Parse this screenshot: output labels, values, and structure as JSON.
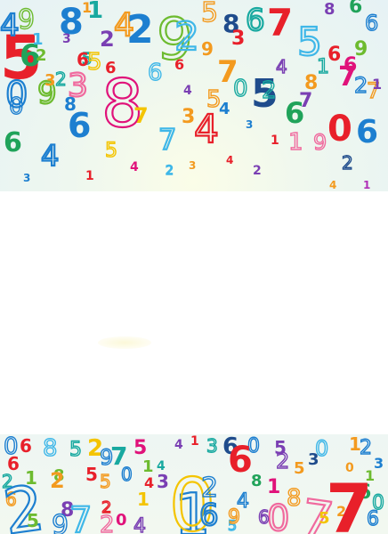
{
  "colors": {
    "red": "#e8202a",
    "magenta": "#e0127a",
    "pink": "#f06a9e",
    "orange": "#f39a1f",
    "yellow": "#f4c400",
    "green": "#6dbb2f",
    "dark_green": "#20a35a",
    "teal": "#18a9a0",
    "blue": "#1d7fd0",
    "navy": "#1f4c8c",
    "purple": "#7a3fb3",
    "violet": "#b02fb8",
    "sky": "#3fb7e8",
    "gray_blue": "#5b7fb3"
  },
  "top_band": {
    "name": "colorful-numbers-top-band",
    "digits": [
      {
        "t": "5",
        "c": "red",
        "s": 68,
        "style": "bold"
      },
      {
        "t": "8",
        "c": "blue",
        "s": 40,
        "style": "bold"
      },
      {
        "t": "1",
        "c": "teal",
        "s": 26,
        "style": "bold"
      },
      {
        "t": "2",
        "c": "purple",
        "s": 24,
        "style": "bold"
      },
      {
        "t": "4",
        "c": "orange",
        "s": 36,
        "style": "outline"
      },
      {
        "t": "2",
        "c": "blue",
        "s": 44,
        "style": "bold"
      },
      {
        "t": "9",
        "c": "green",
        "s": 64,
        "style": "outline"
      },
      {
        "t": "5",
        "c": "orange",
        "s": 30,
        "style": "outline"
      },
      {
        "t": "8",
        "c": "navy",
        "s": 28,
        "style": "bold"
      },
      {
        "t": "6",
        "c": "teal",
        "s": 34,
        "style": "outline"
      },
      {
        "t": "7",
        "c": "red",
        "s": 42,
        "style": "bold"
      },
      {
        "t": "5",
        "c": "sky",
        "s": 44,
        "style": "outline"
      },
      {
        "t": "8",
        "c": "purple",
        "s": 18,
        "style": "bold"
      },
      {
        "t": "6",
        "c": "dark_green",
        "s": 22,
        "style": "bold"
      },
      {
        "t": "6",
        "c": "blue",
        "s": 24,
        "style": "outline"
      },
      {
        "t": "1",
        "c": "orange",
        "s": 16,
        "style": "bold"
      },
      {
        "t": "9",
        "c": "green",
        "s": 30,
        "style": "outline"
      },
      {
        "t": "3",
        "c": "purple",
        "s": 14,
        "style": "bold"
      },
      {
        "t": "5",
        "c": "teal",
        "s": 18,
        "style": "outline"
      },
      {
        "t": "6",
        "c": "red",
        "s": 18,
        "style": "bold"
      },
      {
        "t": "8",
        "c": "magenta",
        "s": 74,
        "style": "outline"
      },
      {
        "t": "7",
        "c": "yellow",
        "s": 24,
        "style": "bold"
      },
      {
        "t": "6",
        "c": "sky",
        "s": 26,
        "style": "outline"
      },
      {
        "t": "6",
        "c": "red",
        "s": 16,
        "style": "bold"
      },
      {
        "t": "2",
        "c": "sky",
        "s": 44,
        "style": "outline"
      },
      {
        "t": "9",
        "c": "orange",
        "s": 20,
        "style": "bold"
      },
      {
        "t": "7",
        "c": "orange",
        "s": 34,
        "style": "bold"
      },
      {
        "t": "3",
        "c": "red",
        "s": 22,
        "style": "bold"
      },
      {
        "t": "4",
        "c": "purple",
        "s": 20,
        "style": "outline"
      },
      {
        "t": "5",
        "c": "navy",
        "s": 44,
        "style": "bold"
      },
      {
        "t": "8",
        "c": "orange",
        "s": 22,
        "style": "bold"
      },
      {
        "t": "1",
        "c": "teal",
        "s": 22,
        "style": "outline"
      },
      {
        "t": "6",
        "c": "red",
        "s": 22,
        "style": "bold"
      },
      {
        "t": "9",
        "c": "green",
        "s": 22,
        "style": "bold"
      },
      {
        "t": "7",
        "c": "magenta",
        "s": 30,
        "style": "bold"
      },
      {
        "t": "0",
        "c": "blue",
        "s": 26,
        "style": "outline"
      },
      {
        "t": "6",
        "c": "dark_green",
        "s": 30,
        "style": "bold"
      },
      {
        "t": "2",
        "c": "teal",
        "s": 20,
        "style": "outline"
      },
      {
        "t": "3",
        "c": "pink",
        "s": 36,
        "style": "outline"
      },
      {
        "t": "6",
        "c": "blue",
        "s": 38,
        "style": "bold"
      },
      {
        "t": "7",
        "c": "sky",
        "s": 32,
        "style": "outline"
      },
      {
        "t": "4",
        "c": "red",
        "s": 44,
        "style": "outline"
      },
      {
        "t": "3",
        "c": "blue",
        "s": 12,
        "style": "bold"
      },
      {
        "t": "6",
        "c": "dark_green",
        "s": 32,
        "style": "bold"
      },
      {
        "t": "4",
        "c": "blue",
        "s": 32,
        "style": "outline"
      },
      {
        "t": "5",
        "c": "yellow",
        "s": 22,
        "style": "outline"
      },
      {
        "t": "4",
        "c": "magenta",
        "s": 14,
        "style": "bold"
      },
      {
        "t": "2",
        "c": "sky",
        "s": 14,
        "style": "outline"
      },
      {
        "t": "3",
        "c": "orange",
        "s": 12,
        "style": "bold"
      },
      {
        "t": "4",
        "c": "red",
        "s": 12,
        "style": "bold"
      },
      {
        "t": "2",
        "c": "purple",
        "s": 14,
        "style": "bold"
      },
      {
        "t": "1",
        "c": "red",
        "s": 14,
        "style": "bold"
      },
      {
        "t": "1",
        "c": "pink",
        "s": 26,
        "style": "outline"
      },
      {
        "t": "9",
        "c": "pink",
        "s": 24,
        "style": "outline"
      },
      {
        "t": "0",
        "c": "red",
        "s": 40,
        "style": "bold"
      },
      {
        "t": "6",
        "c": "blue",
        "s": 36,
        "style": "bold"
      },
      {
        "t": "2",
        "c": "navy",
        "s": 20,
        "style": "outline"
      },
      {
        "t": "4",
        "c": "orange",
        "s": 12,
        "style": "bold"
      },
      {
        "t": "1",
        "c": "violet",
        "s": 12,
        "style": "bold"
      },
      {
        "t": "3",
        "c": "blue",
        "s": 12,
        "style": "bold"
      },
      {
        "t": "1",
        "c": "red",
        "s": 14,
        "style": "bold"
      },
      {
        "t": "4",
        "c": "blue",
        "s": 34,
        "style": "outline"
      },
      {
        "t": "0",
        "c": "blue",
        "s": 40,
        "style": "outline"
      },
      {
        "t": "9",
        "c": "green",
        "s": 34,
        "style": "outline"
      },
      {
        "t": "6",
        "c": "dark_green",
        "s": 34,
        "style": "bold"
      },
      {
        "t": "5",
        "c": "yellow",
        "s": 26,
        "style": "outline"
      },
      {
        "t": "2",
        "c": "teal",
        "s": 26,
        "style": "outline"
      },
      {
        "t": "1",
        "c": "sky",
        "s": 18,
        "style": "bold"
      },
      {
        "t": "3",
        "c": "orange",
        "s": 18,
        "style": "bold"
      },
      {
        "t": "6",
        "c": "red",
        "s": 20,
        "style": "bold"
      },
      {
        "t": "8",
        "c": "blue",
        "s": 20,
        "style": "bold"
      },
      {
        "t": "2",
        "c": "green",
        "s": 18,
        "style": "bold"
      },
      {
        "t": "4",
        "c": "purple",
        "s": 14,
        "style": "bold"
      },
      {
        "t": "5",
        "c": "orange",
        "s": 26,
        "style": "outline"
      },
      {
        "t": "0",
        "c": "teal",
        "s": 26,
        "style": "outline"
      },
      {
        "t": "7",
        "c": "purple",
        "s": 22,
        "style": "bold"
      },
      {
        "t": "3",
        "c": "orange",
        "s": 22,
        "style": "bold"
      },
      {
        "t": "4",
        "c": "blue",
        "s": 18,
        "style": "bold"
      },
      {
        "t": "2",
        "c": "blue",
        "s": 24,
        "style": "outline"
      },
      {
        "t": "7",
        "c": "orange",
        "s": 24,
        "style": "outline"
      },
      {
        "t": "1",
        "c": "purple",
        "s": 16,
        "style": "bold"
      },
      {
        "t": "6",
        "c": "magenta",
        "s": 22,
        "style": "bold"
      }
    ]
  },
  "bottom_band": {
    "name": "colorful-numbers-bottom-band",
    "digits": [
      {
        "t": "0",
        "c": "blue",
        "s": 26,
        "style": "outline"
      },
      {
        "t": "6",
        "c": "red",
        "s": 20,
        "style": "bold"
      },
      {
        "t": "8",
        "c": "sky",
        "s": 26,
        "style": "outline"
      },
      {
        "t": "5",
        "c": "teal",
        "s": 22,
        "style": "outline"
      },
      {
        "t": "2",
        "c": "yellow",
        "s": 26,
        "style": "bold"
      },
      {
        "t": "9",
        "c": "blue",
        "s": 24,
        "style": "outline"
      },
      {
        "t": "7",
        "c": "teal",
        "s": 28,
        "style": "bold"
      },
      {
        "t": "5",
        "c": "magenta",
        "s": 22,
        "style": "bold"
      },
      {
        "t": "4",
        "c": "purple",
        "s": 14,
        "style": "bold"
      },
      {
        "t": "1",
        "c": "red",
        "s": 14,
        "style": "bold"
      },
      {
        "t": "3",
        "c": "teal",
        "s": 20,
        "style": "outline"
      },
      {
        "t": "6",
        "c": "navy",
        "s": 26,
        "style": "bold"
      },
      {
        "t": "0",
        "c": "blue",
        "s": 22,
        "style": "outline"
      },
      {
        "t": "5",
        "c": "purple",
        "s": 20,
        "style": "bold"
      },
      {
        "t": "0",
        "c": "sky",
        "s": 24,
        "style": "outline"
      },
      {
        "t": "1",
        "c": "orange",
        "s": 20,
        "style": "bold"
      },
      {
        "t": "2",
        "c": "blue",
        "s": 22,
        "style": "outline"
      },
      {
        "t": "6",
        "c": "red",
        "s": 20,
        "style": "bold"
      },
      {
        "t": "2",
        "c": "teal",
        "s": 20,
        "style": "outline"
      },
      {
        "t": "8",
        "c": "green",
        "s": 18,
        "style": "bold"
      },
      {
        "t": "5",
        "c": "red",
        "s": 20,
        "style": "bold"
      },
      {
        "t": "6",
        "c": "orange",
        "s": 20,
        "style": "outline"
      },
      {
        "t": "2",
        "c": "blue",
        "s": 70,
        "style": "outline"
      },
      {
        "t": "1",
        "c": "green",
        "s": 20,
        "style": "bold"
      },
      {
        "t": "8",
        "c": "purple",
        "s": 22,
        "style": "bold"
      },
      {
        "t": "2",
        "c": "orange",
        "s": 24,
        "style": "bold"
      },
      {
        "t": "5",
        "c": "orange",
        "s": 20,
        "style": "outline"
      },
      {
        "t": "0",
        "c": "blue",
        "s": 20,
        "style": "outline"
      },
      {
        "t": "1",
        "c": "green",
        "s": 18,
        "style": "bold"
      },
      {
        "t": "4",
        "c": "red",
        "s": 16,
        "style": "bold"
      },
      {
        "t": "7",
        "c": "sky",
        "s": 40,
        "style": "outline"
      },
      {
        "t": "2",
        "c": "red",
        "s": 18,
        "style": "outline"
      },
      {
        "t": "0",
        "c": "magenta",
        "s": 18,
        "style": "bold"
      },
      {
        "t": "1",
        "c": "yellow",
        "s": 20,
        "style": "bold"
      },
      {
        "t": "3",
        "c": "purple",
        "s": 20,
        "style": "bold"
      },
      {
        "t": "4",
        "c": "teal",
        "s": 14,
        "style": "bold"
      },
      {
        "t": "1",
        "c": "blue",
        "s": 64,
        "style": "outline"
      },
      {
        "t": "0",
        "c": "yellow",
        "s": 82,
        "style": "outline"
      },
      {
        "t": "2",
        "c": "blue",
        "s": 30,
        "style": "outline"
      },
      {
        "t": "6",
        "c": "blue",
        "s": 34,
        "style": "outline"
      },
      {
        "t": "6",
        "c": "red",
        "s": 40,
        "style": "bold"
      },
      {
        "t": "4",
        "c": "blue",
        "s": 22,
        "style": "outline"
      },
      {
        "t": "5",
        "c": "sky",
        "s": 16,
        "style": "outline"
      },
      {
        "t": "1",
        "c": "magenta",
        "s": 22,
        "style": "bold"
      },
      {
        "t": "2",
        "c": "purple",
        "s": 24,
        "style": "outline"
      },
      {
        "t": "8",
        "c": "dark_green",
        "s": 18,
        "style": "bold"
      },
      {
        "t": "5",
        "c": "orange",
        "s": 18,
        "style": "bold"
      },
      {
        "t": "3",
        "c": "navy",
        "s": 18,
        "style": "bold"
      },
      {
        "t": "8",
        "c": "orange",
        "s": 26,
        "style": "outline"
      },
      {
        "t": "7",
        "c": "pink",
        "s": 56,
        "style": "outline"
      },
      {
        "t": "0",
        "c": "pink",
        "s": 40,
        "style": "outline"
      },
      {
        "t": "9",
        "c": "orange",
        "s": 22,
        "style": "outline"
      },
      {
        "t": "6",
        "c": "purple",
        "s": 20,
        "style": "outline"
      },
      {
        "t": "5",
        "c": "yellow",
        "s": 18,
        "style": "bold"
      },
      {
        "t": "2",
        "c": "orange",
        "s": 16,
        "style": "bold"
      },
      {
        "t": "6",
        "c": "dark_green",
        "s": 22,
        "style": "bold"
      },
      {
        "t": "1",
        "c": "green",
        "s": 16,
        "style": "bold"
      },
      {
        "t": "0",
        "c": "orange",
        "s": 14,
        "style": "bold"
      },
      {
        "t": "3",
        "c": "blue",
        "s": 16,
        "style": "bold"
      },
      {
        "t": "7",
        "c": "red",
        "s": 76,
        "style": "bold"
      },
      {
        "t": "6",
        "c": "blue",
        "s": 22,
        "style": "outline"
      },
      {
        "t": "0",
        "c": "teal",
        "s": 22,
        "style": "outline"
      },
      {
        "t": "5",
        "c": "green",
        "s": 20,
        "style": "bold"
      },
      {
        "t": "2",
        "c": "pink",
        "s": 26,
        "style": "outline"
      },
      {
        "t": "4",
        "c": "purple",
        "s": 22,
        "style": "outline"
      },
      {
        "t": "9",
        "c": "blue",
        "s": 30,
        "style": "outline"
      }
    ]
  }
}
